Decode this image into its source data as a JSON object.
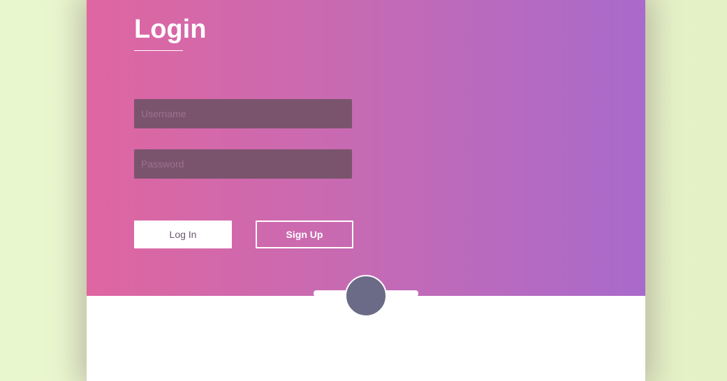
{
  "login": {
    "title": "Login",
    "username_placeholder": "Username",
    "password_placeholder": "Password",
    "login_label": "Log In",
    "signup_label": "Sign Up"
  },
  "colors": {
    "page_background": "#e9f7cf",
    "gradient_start": "#df66a1",
    "gradient_end": "#a96acb",
    "input_background": "#7a546d",
    "avatar": "#6b6b87"
  }
}
